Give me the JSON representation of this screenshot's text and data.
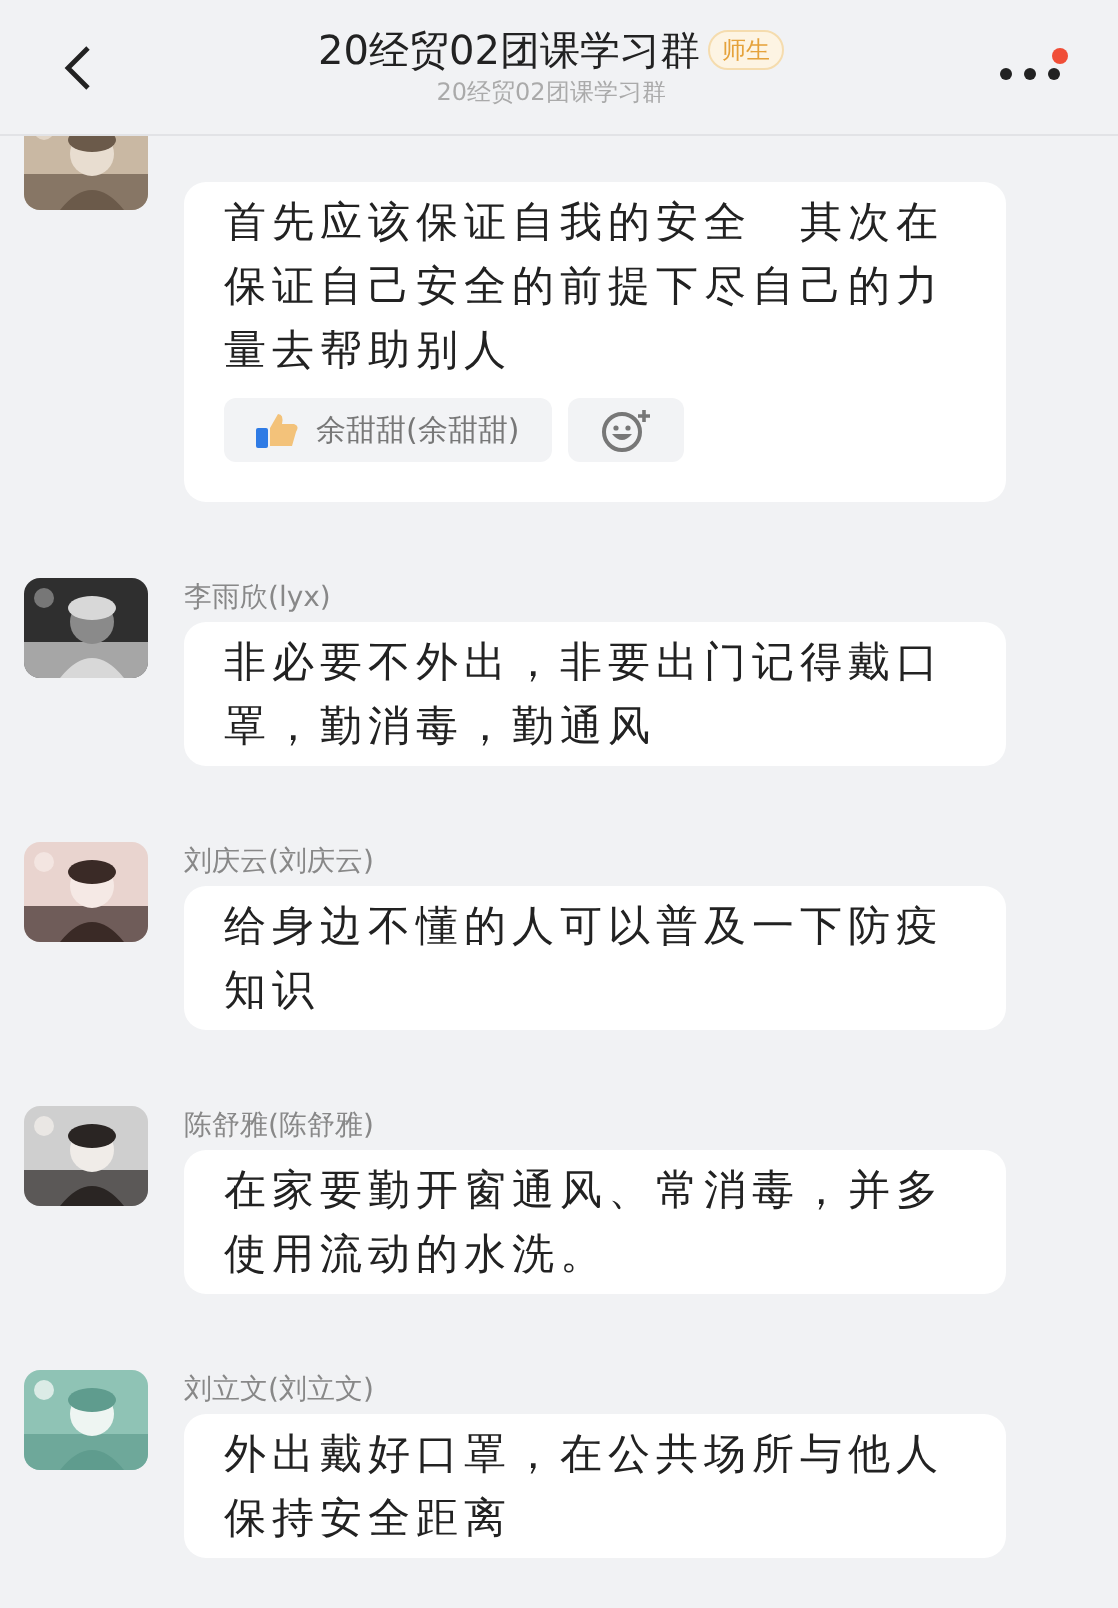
{
  "header": {
    "title": "20经贸02团课学习群",
    "badge": "师生",
    "subtitle": "20经贸02团课学习群",
    "has_notification": true
  },
  "messages": [
    {
      "text": "首先应该保证自我的安全　其次在保证自己安全的前提下尽自己的力量去帮助别人",
      "reactions": [
        "余甜甜(余甜甜)"
      ]
    },
    {
      "sender": "李雨欣(lyx)",
      "text": "非必要不外出，非要出门记得戴口罩，勤消毒，勤通风"
    },
    {
      "sender": "刘庆云(刘庆云)",
      "text": "给身边不懂的人可以普及一下防疫知识"
    },
    {
      "sender": "陈舒雅(陈舒雅)",
      "text": "在家要勤开窗通风、常消毒，并多使用流动的水洗。"
    },
    {
      "sender": "刘立文(刘立文)",
      "text": "外出戴好口罩，在公共场所与他人保持安全距离"
    }
  ]
}
